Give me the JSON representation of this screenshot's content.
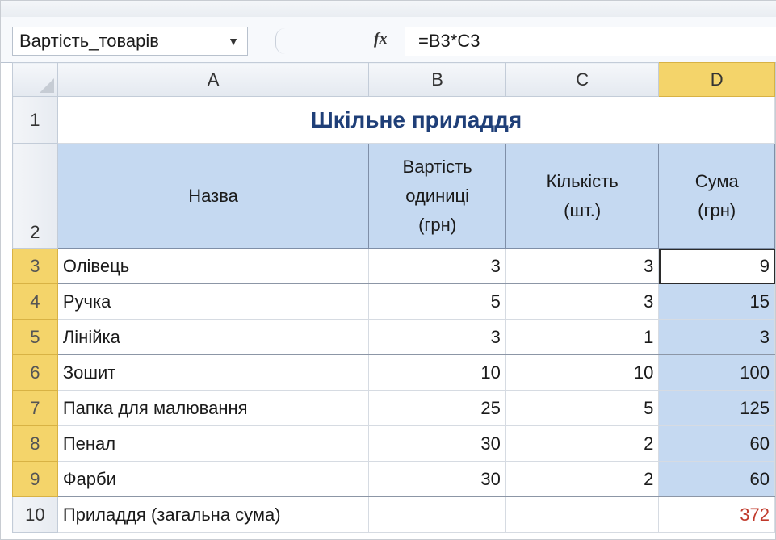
{
  "formula_bar": {
    "name_box": "Вартість_товарів",
    "fx_label": "fx",
    "formula": "=B3*C3"
  },
  "sheet": {
    "columns": [
      "A",
      "B",
      "C",
      "D"
    ],
    "selected_column": "D",
    "title": "Шкільне приладдя",
    "headers": {
      "a": "Назва",
      "b": [
        "Вартість",
        "одиниці",
        "(грн)"
      ],
      "c": [
        "Кількість",
        "(шт.)"
      ],
      "d": [
        "Сума",
        "(грн)"
      ]
    },
    "rows": [
      {
        "n": "3",
        "name": "Олівець",
        "price": "3",
        "qty": "3",
        "sum": "9"
      },
      {
        "n": "4",
        "name": "Ручка",
        "price": "5",
        "qty": "3",
        "sum": "15"
      },
      {
        "n": "5",
        "name": "Лінійка",
        "price": "3",
        "qty": "1",
        "sum": "3"
      },
      {
        "n": "6",
        "name": "Зошит",
        "price": "10",
        "qty": "10",
        "sum": "100"
      },
      {
        "n": "7",
        "name": "Папка для малювання",
        "price": "25",
        "qty": "5",
        "sum": "125"
      },
      {
        "n": "8",
        "name": "Пенал",
        "price": "30",
        "qty": "2",
        "sum": "60"
      },
      {
        "n": "9",
        "name": "Фарби",
        "price": "30",
        "qty": "2",
        "sum": "60"
      }
    ],
    "total_row": {
      "n": "10",
      "label": "Приладдя (загальна сума)",
      "sum": "372"
    },
    "row_numbers": {
      "title": "1",
      "header": "2"
    },
    "colors": {
      "header_fill": "#c5d9f1",
      "selected_header": "#f4d46a",
      "title_text": "#1f3f78",
      "total_text": "#c0392b"
    }
  }
}
